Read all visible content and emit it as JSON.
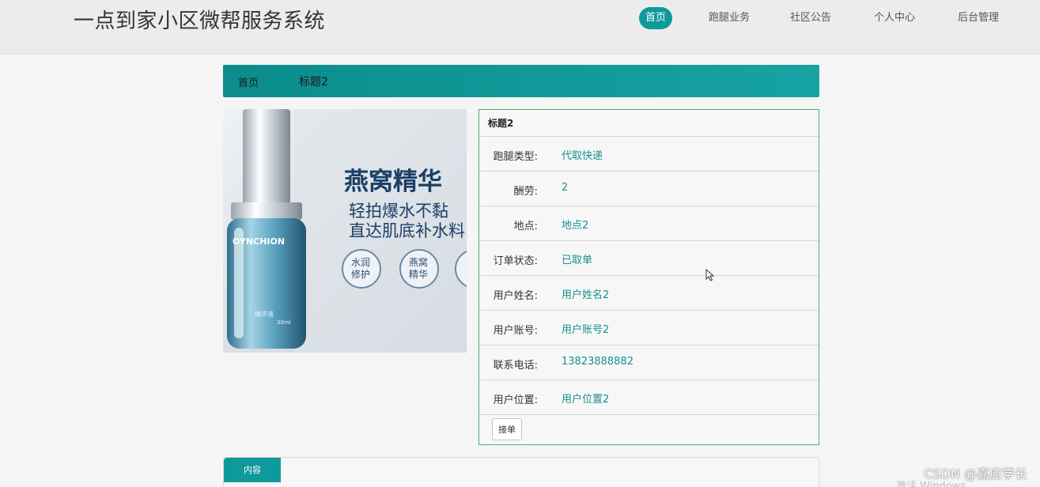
{
  "header": {
    "site_title": "一点到家小区微帮服务系统",
    "nav": [
      {
        "label": "首页",
        "active": true
      },
      {
        "label": "跑腿业务",
        "active": false
      },
      {
        "label": "社区公告",
        "active": false
      },
      {
        "label": "个人中心",
        "active": false
      },
      {
        "label": "后台管理",
        "active": false
      }
    ]
  },
  "breadcrumb": {
    "home": "首页",
    "current": "标题2"
  },
  "product_image": {
    "brand_text": "OYNCHION",
    "headline": "燕窝精华",
    "line1": "轻拍爆水不黏",
    "line2": "直达肌底补水料",
    "badge1_line1": "水润",
    "badge1_line2": "修护",
    "badge2_line1": "燕窝",
    "badge2_line2": "精华",
    "bottle_label": "精华液",
    "bottle_volume": "30ml"
  },
  "detail": {
    "title": "标题2",
    "rows": [
      {
        "label": "跑腿类型:",
        "value": "代取快递"
      },
      {
        "label": "酬劳:",
        "value": "2"
      },
      {
        "label": "地点:",
        "value": "地点2"
      },
      {
        "label": "订单状态:",
        "value": "已取单"
      },
      {
        "label": "用户姓名:",
        "value": "用户姓名2"
      },
      {
        "label": "用户账号:",
        "value": "用户账号2"
      },
      {
        "label": "联系电话:",
        "value": "13823888882"
      },
      {
        "label": "用户位置:",
        "value": "用户位置2"
      }
    ],
    "accept_button": "接单"
  },
  "content_tab": {
    "label": "内容"
  },
  "watermark": "CSDN @嘉应学长",
  "windows_activation": "激活 Windows",
  "colors": {
    "accent": "#0e9a9a",
    "value_text": "#1a8f8f",
    "detail_border": "#4caf6f"
  }
}
